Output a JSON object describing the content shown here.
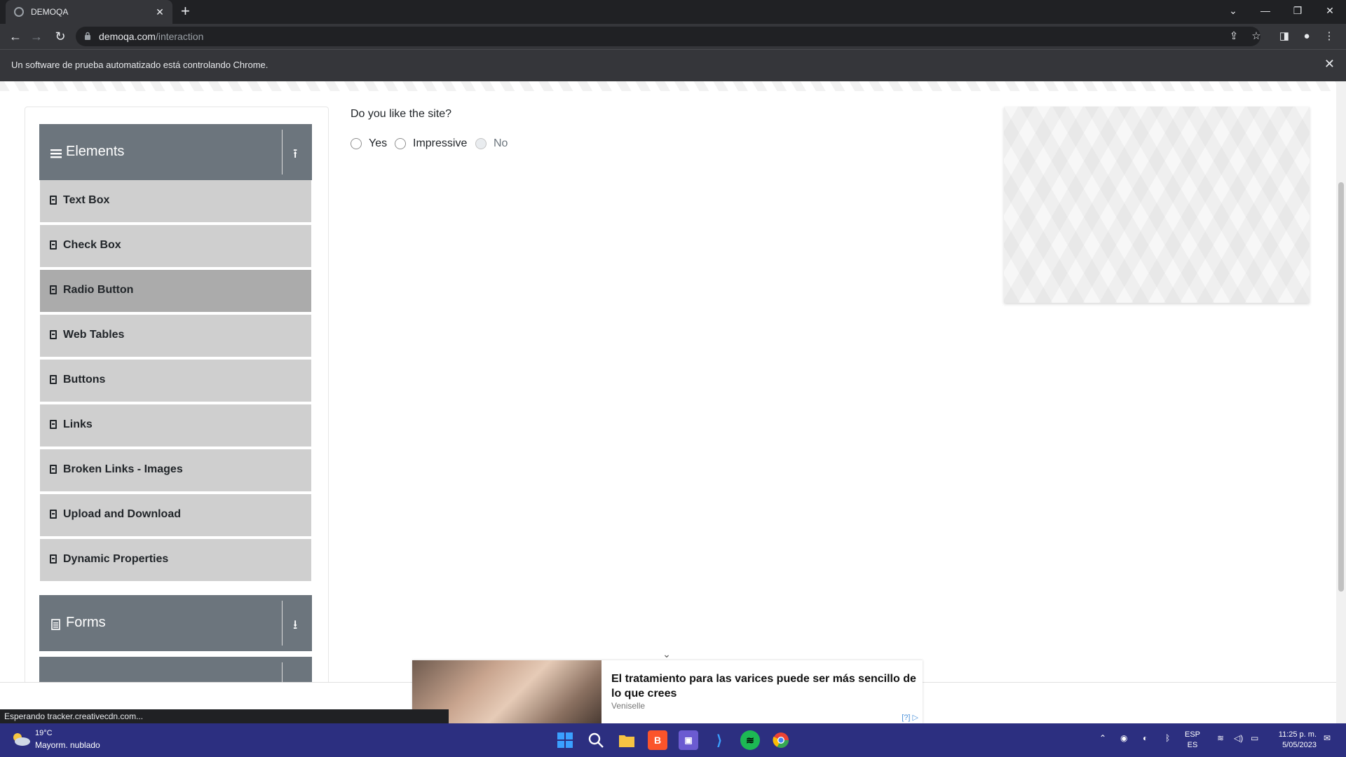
{
  "browser": {
    "tab_title": "DEMOQA",
    "tab_close": "✕",
    "new_tab": "+",
    "url_domain": "demoqa.com",
    "url_path": "/interaction",
    "infobar_message": "Un software de prueba automatizado está controlando Chrome.",
    "infobar_close": "✕"
  },
  "sidebar": {
    "elements_header": "Elements",
    "items": [
      {
        "label": "Text Box"
      },
      {
        "label": "Check Box"
      },
      {
        "label": "Radio Button"
      },
      {
        "label": "Web Tables"
      },
      {
        "label": "Buttons"
      },
      {
        "label": "Links"
      },
      {
        "label": "Broken Links - Images"
      },
      {
        "label": "Upload and Download"
      },
      {
        "label": "Dynamic Properties"
      }
    ],
    "active_item": "Radio Button",
    "forms_header": "Forms"
  },
  "main": {
    "question": "Do you like the site?",
    "options": [
      {
        "label": "Yes",
        "disabled": false
      },
      {
        "label": "Impressive",
        "disabled": false
      },
      {
        "label": "No",
        "disabled": true
      }
    ]
  },
  "bottom_ad": {
    "headline": "El tratamiento para las varices puede ser más sencillo de lo que crees",
    "brand": "Veniselle",
    "tag": "[?] ▷"
  },
  "status_bar": "Esperando tracker.creativecdn.com...",
  "taskbar": {
    "temperature": "19°C",
    "weather_desc": "Mayorm. nublado",
    "lang_top": "ESP",
    "lang_bottom": "ES",
    "time": "11:25 p. m.",
    "date": "5/05/2023"
  },
  "colors": {
    "menu_header": "#6c757d",
    "menu_item": "#cfcfcf",
    "menu_item_active": "#ababab",
    "taskbar": "#2c2f80"
  }
}
